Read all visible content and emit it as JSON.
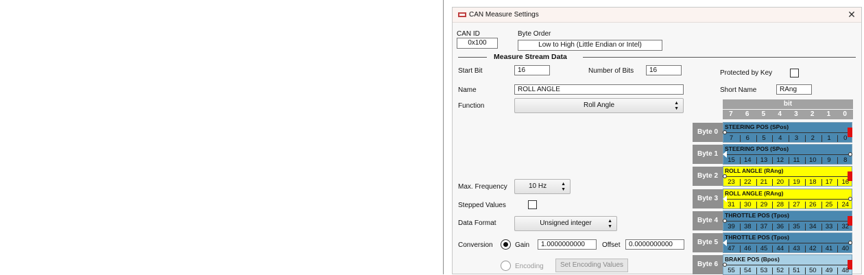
{
  "window": {
    "title": "CAN Measure Settings",
    "close_icon": "close-icon"
  },
  "can_id": {
    "label": "CAN ID",
    "value": "0x100"
  },
  "byte_order": {
    "label": "Byte Order",
    "value": "Low to High (Little Endian or Intel)"
  },
  "section_title": "Measure Stream Data",
  "start_bit": {
    "label": "Start Bit",
    "value": "16"
  },
  "number_of_bits": {
    "label": "Number of Bits",
    "value": "16"
  },
  "protected_by_key": {
    "label": "Protected by Key",
    "checked": false
  },
  "name": {
    "label": "Name",
    "value": "ROLL ANGLE"
  },
  "short_name": {
    "label": "Short Name",
    "value": "RAng"
  },
  "function": {
    "label": "Function",
    "value": "Roll Angle"
  },
  "max_frequency": {
    "label": "Max. Frequency",
    "value": "10 Hz"
  },
  "stepped_values": {
    "label": "Stepped Values",
    "checked": false
  },
  "data_format": {
    "label": "Data Format",
    "value": "Unsigned integer"
  },
  "conversion": {
    "label": "Conversion",
    "gain_label": "Gain",
    "gain_value": "1.0000000000",
    "offset_label": "Offset",
    "offset_value": "0.0000000000",
    "encoding_label": "Encoding",
    "set_encoding_button": "Set Encoding Values",
    "selected": "gain"
  },
  "bit_grid": {
    "header": "bit",
    "bit_numbers": [
      "7",
      "6",
      "5",
      "4",
      "3",
      "2",
      "1",
      "0"
    ],
    "colors": {
      "blue": "#4a88b0",
      "yellow": "#ffff00",
      "light_blue": "#a9d0e5",
      "header_gray": "#a2a2a2"
    },
    "bytes": [
      {
        "label": "Byte 0",
        "signal": "STEERING POS (SPos)",
        "bits": [
          "7",
          "6",
          "5",
          "4",
          "3",
          "2",
          "1",
          "0"
        ],
        "color": "blue",
        "start_marker": "circle",
        "end_marker": "red"
      },
      {
        "label": "Byte 1",
        "signal": "STEERING POS (SPos)",
        "bits": [
          "15",
          "14",
          "13",
          "12",
          "11",
          "10",
          "9",
          "8"
        ],
        "color": "blue",
        "start_marker": "triangle",
        "end_marker": "circle"
      },
      {
        "label": "Byte 2",
        "signal": "ROLL ANGLE (RAng)",
        "bits": [
          "23",
          "22",
          "21",
          "20",
          "19",
          "18",
          "17",
          "16"
        ],
        "color": "yellow",
        "start_marker": "circle",
        "end_marker": "red"
      },
      {
        "label": "Byte 3",
        "signal": "ROLL ANGLE (RAng)",
        "bits": [
          "31",
          "30",
          "29",
          "28",
          "27",
          "26",
          "25",
          "24"
        ],
        "color": "yellow",
        "start_marker": "triangle",
        "end_marker": "circle"
      },
      {
        "label": "Byte 4",
        "signal": "THROTTLE POS (Tpos)",
        "bits": [
          "39",
          "38",
          "37",
          "36",
          "35",
          "34",
          "33",
          "32"
        ],
        "color": "blue",
        "start_marker": "circle",
        "end_marker": "red"
      },
      {
        "label": "Byte 5",
        "signal": "THROTTLE POS (Tpos)",
        "bits": [
          "47",
          "46",
          "45",
          "44",
          "43",
          "42",
          "41",
          "40"
        ],
        "color": "blue",
        "start_marker": "triangle",
        "end_marker": "circle"
      },
      {
        "label": "Byte 6",
        "signal": "BRAKE POS (Bpos)",
        "bits": [
          "55",
          "54",
          "53",
          "52",
          "51",
          "50",
          "49",
          "48"
        ],
        "color": "light_blue",
        "start_marker": "circle",
        "end_marker": "red"
      }
    ]
  }
}
